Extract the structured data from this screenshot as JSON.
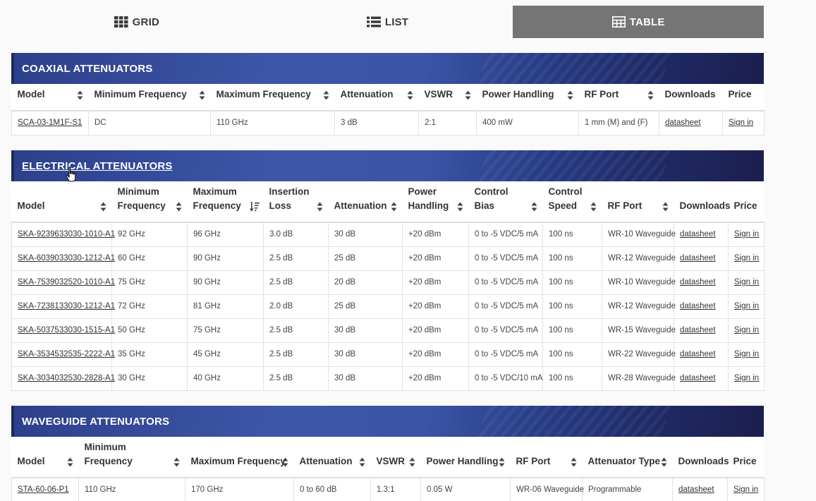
{
  "view_toggle": {
    "grid_label": "GRID",
    "list_label": "LIST",
    "table_label": "TABLE"
  },
  "sections": [
    {
      "title": "COAXIAL ATTENUATORS",
      "headers": [
        "Model",
        "Minimum Frequency",
        "Maximum Frequency",
        "Attenuation",
        "VSWR",
        "Power Handling",
        "RF Port",
        "Downloads",
        "Price"
      ],
      "rows": [
        [
          "SCA-03-1M1F-S1",
          "DC",
          "110 GHz",
          "3 dB",
          "2:1",
          "400 mW",
          "1 mm (M) and (F)",
          "datasheet",
          "Sign in"
        ]
      ]
    },
    {
      "title": "ELECTRICAL ATTENUATORS",
      "headers": [
        [
          "Model"
        ],
        [
          "Minimum",
          "Frequency"
        ],
        [
          "Maximum",
          "Frequency"
        ],
        [
          "Insertion",
          "Loss"
        ],
        [
          "Attenuation"
        ],
        [
          "Power",
          "Handling"
        ],
        [
          "Control",
          "Bias"
        ],
        [
          "Control",
          "Speed"
        ],
        [
          "RF Port"
        ],
        [
          "Downloads"
        ],
        [
          "Price"
        ]
      ],
      "rows": [
        [
          "SKA-9239633030-1010-A1",
          "92 GHz",
          "96 GHz",
          "3.0 dB",
          "30 dB",
          "+20 dBm",
          "0 to -5 VDC/5 mA",
          "100 ns",
          "WR-10 Waveguide",
          "datasheet",
          "Sign in"
        ],
        [
          "SKA-6039033030-1212-A1",
          "60 GHz",
          "90 GHz",
          "2.5 dB",
          "25 dB",
          "+20 dBm",
          "0 to -5 VDC/5 mA",
          "100 ns",
          "WR-12 Waveguide",
          "datasheet",
          "Sign in"
        ],
        [
          "SKA-7539032520-1010-A1",
          "75 GHz",
          "90 GHz",
          "2.5 dB",
          "20 dB",
          "+20 dBm",
          "0 to -5 VDC/5 mA",
          "100 ns",
          "WR-10 Waveguide",
          "datasheet",
          "Sign in"
        ],
        [
          "SKA-7238133030-1212-A1",
          "72 GHz",
          "81 GHz",
          "2.0 dB",
          "25 dB",
          "+20 dBm",
          "0 to -5 VDC/5 mA",
          "100 ns",
          "WR-12 Waveguide",
          "datasheet",
          "Sign in"
        ],
        [
          "SKA-5037533030-1515-A1",
          "50 GHz",
          "75 GHz",
          "2.5 dB",
          "30 dB",
          "+20 dBm",
          "0 to -5 VDC/5 mA",
          "100 ns",
          "WR-15 Waveguide",
          "datasheet",
          "Sign in"
        ],
        [
          "SKA-3534532535-2222-A1",
          "35 GHz",
          "45 GHz",
          "2.5 dB",
          "30 dB",
          "+20 dBm",
          "0 to -5 VDC/5 mA",
          "100 ns",
          "WR-22 Waveguide",
          "datasheet",
          "Sign in"
        ],
        [
          "SKA-3034032530-2828-A1",
          "30 GHz",
          "40 GHz",
          "2.5 dB",
          "30 dB",
          "+20 dBm",
          "0 to -5 VDC/10 mA",
          "100 ns",
          "WR-28 Waveguide",
          "datasheet",
          "Sign in"
        ]
      ]
    },
    {
      "title": "WAVEGUIDE ATTENUATORS",
      "headers": [
        [
          "Model"
        ],
        [
          "Minimum",
          "Frequency"
        ],
        [
          "Maximum Frequency"
        ],
        [
          "Attenuation"
        ],
        [
          "VSWR"
        ],
        [
          "Power Handling"
        ],
        [
          "RF Port"
        ],
        [
          "Attenuator Type"
        ],
        [
          "Downloads"
        ],
        [
          "Price"
        ]
      ],
      "rows": [
        [
          "STA-60-06-P1",
          "110 GHz",
          "170 GHz",
          "0 to 60 dB",
          "1.3:1",
          "0.05 W",
          "WR-06 Waveguide",
          "Programmable",
          "datasheet",
          "Sign in"
        ]
      ]
    }
  ],
  "colors": {
    "active_toggle": "#757575",
    "banner_start": "#3e56a8",
    "banner_end": "#1c1f4e"
  }
}
